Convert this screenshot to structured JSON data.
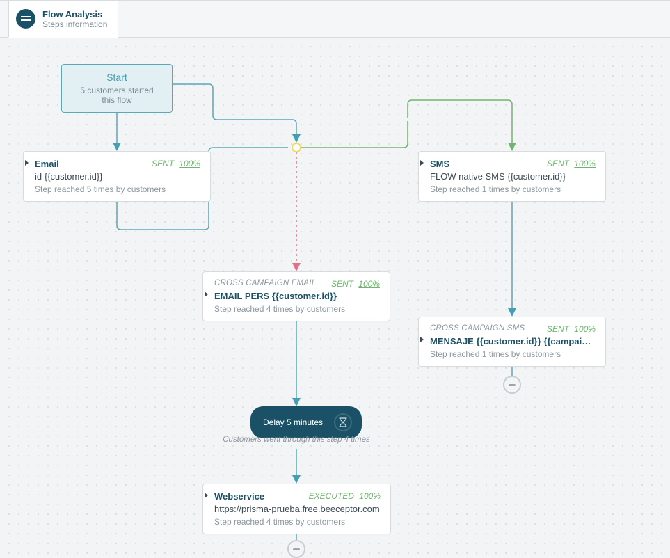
{
  "tab": {
    "title": "Flow Analysis",
    "subtitle": "Steps information"
  },
  "start": {
    "label": "Start",
    "subtitle": "5 customers started this flow"
  },
  "nodes": {
    "email": {
      "kind": "Email",
      "status": "SENT",
      "pct": "100%",
      "body": "id {{customer.id}}",
      "meta": "Step reached 5 times by customers"
    },
    "cross_email": {
      "kind": "CROSS CAMPAIGN EMAIL",
      "status": "SENT",
      "pct": "100%",
      "body": "EMAIL PERS {{customer.id}}",
      "meta": "Step reached 4 times by customers"
    },
    "sms": {
      "kind": "SMS",
      "status": "SENT",
      "pct": "100%",
      "body": "FLOW native SMS {{customer.id}}",
      "meta": "Step reached 1 times by customers"
    },
    "cross_sms": {
      "kind": "CROSS CAMPAIGN SMS",
      "status": "SENT",
      "pct": "100%",
      "body": "MENSAJE {{customer.id}} {{campaign.li…",
      "meta": "Step reached 1 times by customers"
    },
    "webservice": {
      "kind": "Webservice",
      "status": "EXECUTED",
      "pct": "100%",
      "body": "https://prisma-prueba.free.beeceptor.com",
      "meta": "Step reached 4 times by customers"
    }
  },
  "delay": {
    "label": "Delay 5 minutes",
    "caption": "Customers went through this step 4 times"
  },
  "colors": {
    "teal": "#58a8b8",
    "green": "#6fb56f",
    "pink": "#e56f8a",
    "yellow": "#f4e27a"
  }
}
